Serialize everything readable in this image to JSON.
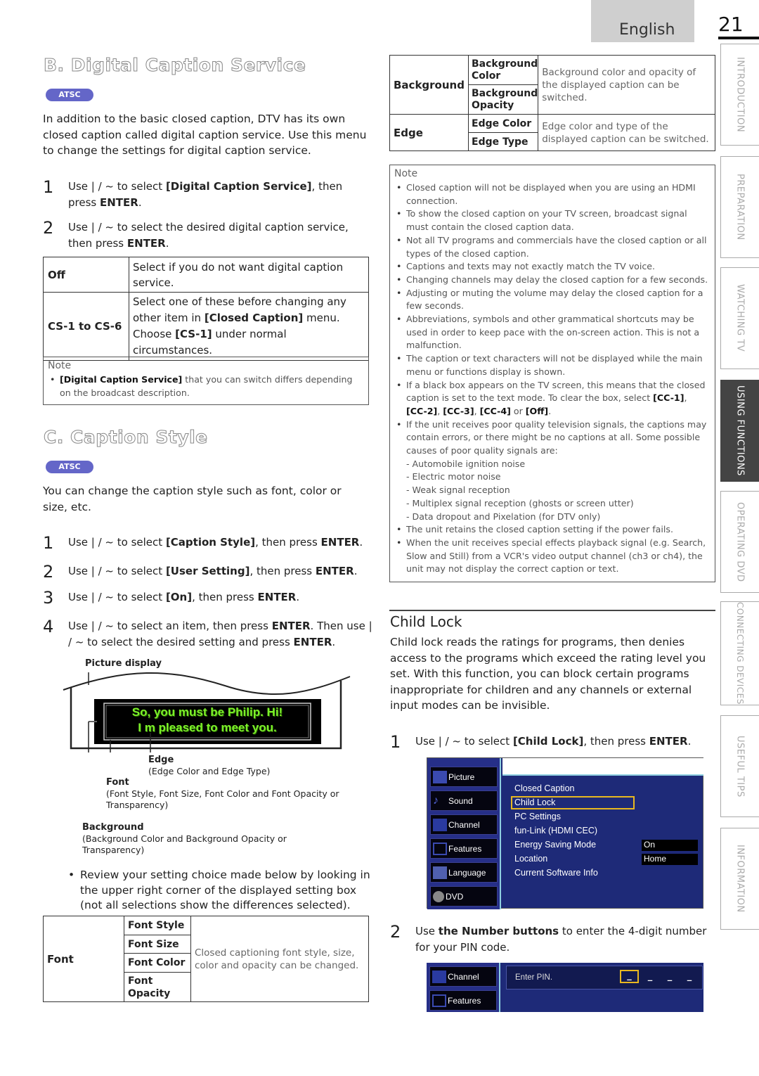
{
  "header": {
    "language": "English",
    "page_number": "21"
  },
  "side_tabs": [
    {
      "label": "INTRODUCTION",
      "active": false
    },
    {
      "label": "PREPARATION",
      "active": false
    },
    {
      "label": "WATCHING TV",
      "active": false
    },
    {
      "label": "USING FUNCTIONS",
      "active": true
    },
    {
      "label": "OPERATING DVD",
      "active": false
    },
    {
      "label": "CONNECTING DEVICES",
      "active": false
    },
    {
      "label": "USEFUL TIPS",
      "active": false
    },
    {
      "label": "INFORMATION",
      "active": false
    }
  ],
  "section_b": {
    "title": "B. Digital Caption Service",
    "badge": "ATSC",
    "intro": "In addition to the basic closed caption, DTV has its own closed caption called digital caption service. Use this menu to change the settings for digital caption service.",
    "steps": [
      {
        "num": "1",
        "pre": "Use  | / ~  to select ",
        "bold": "[Digital Caption Service]",
        "post": ", then press ",
        "bold2": "ENTER",
        "end": "."
      },
      {
        "num": "2",
        "pre": "Use  | / ~  to select the desired digital caption service, then press ",
        "bold": "ENTER",
        "post": ".",
        "bold2": "",
        "end": ""
      }
    ],
    "table": [
      {
        "key": "Off",
        "desc": "Select if you do not want digital caption service."
      },
      {
        "key": "CS-1 to CS-6",
        "desc_pre": "Select one of these before changing any other item in ",
        "desc_b1": "[Closed Caption]",
        "desc_mid": " menu. Choose ",
        "desc_b2": "[CS-1]",
        "desc_post": " under normal circumstances."
      }
    ],
    "note": {
      "title": "Note",
      "item_bold": "[Digital Caption Service]",
      "item_text": " that you can switch differs depending on the broadcast description."
    }
  },
  "section_c": {
    "title": "C. Caption Style",
    "badge": "ATSC",
    "intro": "You can change the caption style such as font, color or size, etc.",
    "steps": [
      {
        "num": "1",
        "pre": "Use  | / ~  to select ",
        "bold": "[Caption Style]",
        "post": ", then press ",
        "bold2": "ENTER",
        "end": "."
      },
      {
        "num": "2",
        "pre": "Use  | / ~  to select ",
        "bold": "[User Setting]",
        "post": ", then press ",
        "bold2": "ENTER",
        "end": "."
      },
      {
        "num": "3",
        "pre": "Use  | / ~  to select ",
        "bold": "[On]",
        "post": ", then press ",
        "bold2": "ENTER",
        "end": "."
      },
      {
        "num": "4",
        "pre": "Use  | / ~  to select an item, then press ",
        "bold": "ENTER",
        "post": ". Then use  | / ~  to select the desired setting and press ",
        "bold2": "ENTER",
        "end": "."
      }
    ],
    "diagram": {
      "picture_label": "Picture display",
      "caption_line1": "So, you must be Philip. Hi!",
      "caption_line2": "I m pleased to meet you.",
      "edge_label": "Edge",
      "edge_desc": "(Edge Color and Edge Type)",
      "font_label": "Font",
      "font_desc": "(Font Style, Font Size, Font Color and Font Opacity or Transparency)",
      "bg_label": "Background",
      "bg_desc": "(Background Color and Background Opacity or Transparency)",
      "caption_color": "#7cf02a"
    },
    "review_text": "Review your setting choice made below by looking in the upper right corner of the displayed setting box (not all selections show the differences selected).",
    "font_table": {
      "group": "Font",
      "items": [
        "Font Style",
        "Font Size",
        "Font Color",
        "Font Opacity"
      ],
      "desc": "Closed captioning font style, size, color and opacity can be changed."
    }
  },
  "style_table": {
    "rows": [
      {
        "group": "Background",
        "items": [
          "Background Color",
          "Background Opacity"
        ],
        "desc": "Background color and opacity of the displayed caption can be switched."
      },
      {
        "group": "Edge",
        "items": [
          "Edge Color",
          "Edge Type"
        ],
        "desc": "Edge color and type of the displayed caption can be switched."
      }
    ]
  },
  "cc_note": {
    "title": "Note",
    "items": [
      {
        "text": "Closed caption will not be displayed when you are using an HDMI connection."
      },
      {
        "text": "To show the closed caption on your TV screen, broadcast signal must contain the closed caption data."
      },
      {
        "text": "Not all TV programs and commercials have the closed caption or all types of the closed caption."
      },
      {
        "text": "Captions and texts may not exactly match the TV voice."
      },
      {
        "text": "Changing channels may delay the closed caption for a few seconds."
      },
      {
        "text": "Adjusting or muting the volume may delay the closed caption for a few seconds."
      },
      {
        "text": "Abbreviations, symbols and other grammatical shortcuts may be used in order to keep pace with the on-screen action. This is not a malfunction."
      },
      {
        "text": "The caption or text characters will not be displayed while the main menu or functions display is shown."
      }
    ],
    "blackbox": {
      "pre": "If a black box appears on the TV screen, this means that the closed caption is set to the text mode. To clear the box, select ",
      "b1": "[CC-1]",
      "s1": ", ",
      "b2": "[CC-2]",
      "s2": ", ",
      "b3": "[CC-3]",
      "s3": ", ",
      "b4": "[CC-4]",
      "s4": " or ",
      "b5": "[Off]",
      "end": "."
    },
    "poor_signal": "If the unit receives poor quality television signals, the captions may contain errors, or there might be no captions at all. Some possible causes of poor quality signals are:",
    "causes": [
      "- Automobile ignition noise",
      "- Electric motor noise",
      "- Weak signal reception",
      "- Multiplex signal reception (ghosts or screen   utter)",
      "- Data dropout and Pixelation (for DTV only)"
    ],
    "tail": [
      "The unit retains the closed caption setting if the power fails.",
      "When the unit receives special effects playback signal (e.g. Search, Slow and Still) from a VCR's video output channel (ch3 or ch4), the unit may not display the correct caption or text."
    ]
  },
  "child_lock": {
    "title": "Child Lock",
    "intro": "Child lock reads the ratings for programs, then denies access to the programs which exceed the rating level you set. With this function, you can block certain programs inappropriate for children and any channels or external input modes can be invisible.",
    "step1": {
      "num": "1",
      "pre": "Use  | / ~  to select ",
      "bold": "[Child Lock]",
      "post": ", then press ",
      "bold2": "ENTER",
      "end": "."
    },
    "step2": {
      "num": "2",
      "pre": "Use ",
      "bold": "the Number buttons",
      "post": " to enter the 4-digit number for your PIN code."
    },
    "menu": {
      "left": [
        "Picture",
        "Sound",
        "Channel",
        "Features",
        "Language",
        "DVD"
      ],
      "right": [
        "Closed Caption",
        "Child Lock",
        "PC Settings",
        "fun-Link (HDMI CEC)",
        "Energy Saving Mode",
        "Location",
        "Current Software Info"
      ],
      "selected": "Child Lock",
      "values": {
        "energy": "On",
        "location": "Home"
      },
      "menu_bg": "#1e2a78",
      "highlight": "#e8b820"
    },
    "pin_menu": {
      "left": [
        "Channel",
        "Features"
      ],
      "prompt": "Enter PIN.",
      "digits": [
        "_",
        "_",
        "_",
        "_"
      ]
    }
  }
}
